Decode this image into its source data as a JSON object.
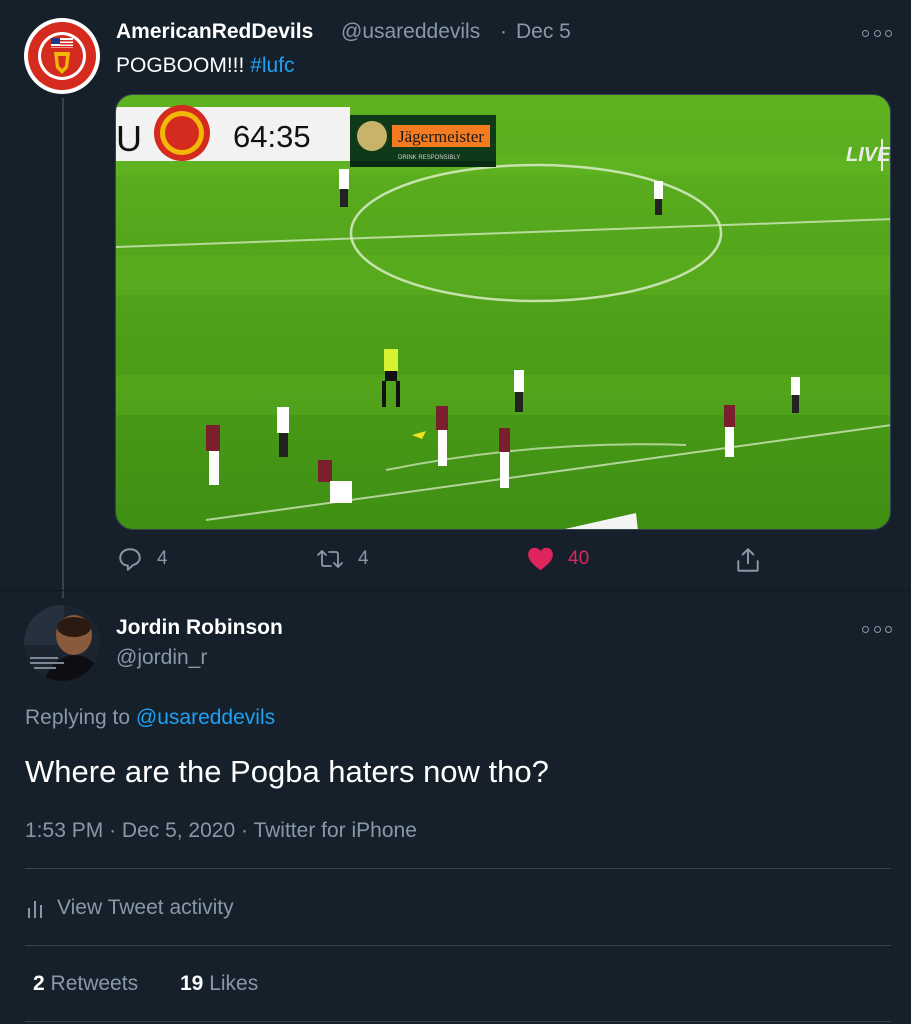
{
  "colors": {
    "background": "#15202b",
    "muted": "#8899a6",
    "link": "#1da1f2",
    "like": "#e0245e",
    "divider": "#38444d",
    "pitch": "#4fa21c"
  },
  "parent_tweet": {
    "display_name": "AmericanRedDevils",
    "handle": "@usareddevils",
    "separator": "·",
    "date": "Dec 5",
    "text": "POGBOOM!!!",
    "hashtag": "#lufc",
    "media": {
      "scoreboard_left": "U",
      "clock": "64:35",
      "sponsor": "Jägermeister",
      "sponsor_sub": "DRINK RESPONSIBLY",
      "badge": "LIVE"
    },
    "actions": {
      "reply_icon": "reply-icon",
      "reply_count": "4",
      "retweet_icon": "retweet-icon",
      "retweet_count": "4",
      "like_icon": "heart-icon",
      "like_count": "40",
      "share_icon": "share-icon"
    }
  },
  "reply_tweet": {
    "display_name": "Jordin Robinson",
    "handle": "@jordin_r",
    "replying_prefix": "Replying to",
    "replying_handle": "@usareddevils",
    "text": "Where are the Pogba haters now tho?",
    "time": "1:53 PM",
    "date": "Dec 5, 2020",
    "source": "Twitter for iPhone",
    "separator": "·",
    "activity_icon": "analytics-icon",
    "activity_label": "View Tweet activity",
    "retweets_count": "2",
    "retweets_label": "Retweets",
    "likes_count": "19",
    "likes_label": "Likes"
  }
}
